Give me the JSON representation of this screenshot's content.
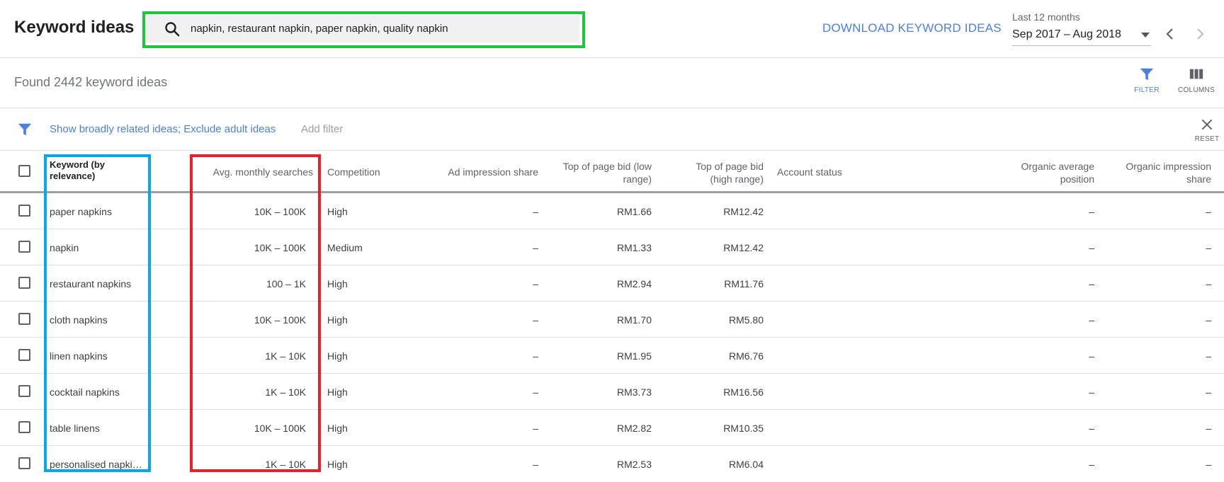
{
  "header": {
    "title": "Keyword ideas",
    "search_value": "napkin, restaurant napkin, paper napkin, quality napkin",
    "download_label": "DOWNLOAD KEYWORD IDEAS",
    "date_range_label": "Last 12 months",
    "date_range_value": "Sep 2017 – Aug 2018"
  },
  "summary": {
    "found_text": "Found 2442 keyword ideas",
    "filter_label": "FILTER",
    "columns_label": "COLUMNS"
  },
  "filter_bar": {
    "active_filter": "Show broadly related ideas; Exclude adult ideas",
    "add_filter_label": "Add filter",
    "reset_label": "RESET"
  },
  "table": {
    "columns": [
      "Keyword (by relevance)",
      "Avg. monthly searches",
      "Competition",
      "Ad impression share",
      "Top of page bid (low range)",
      "Top of page bid (high range)",
      "Account status",
      "Organic average position",
      "Organic impression share"
    ],
    "rows": [
      {
        "keyword": "paper napkins",
        "searches": "10K – 100K",
        "competition": "High",
        "ad_share": "–",
        "bid_low": "RM1.66",
        "bid_high": "RM12.42",
        "account_status": "",
        "organic_position": "–",
        "organic_share": "–"
      },
      {
        "keyword": "napkin",
        "searches": "10K – 100K",
        "competition": "Medium",
        "ad_share": "–",
        "bid_low": "RM1.33",
        "bid_high": "RM12.42",
        "account_status": "",
        "organic_position": "–",
        "organic_share": "–"
      },
      {
        "keyword": "restaurant napkins",
        "searches": "100 – 1K",
        "competition": "High",
        "ad_share": "–",
        "bid_low": "RM2.94",
        "bid_high": "RM11.76",
        "account_status": "",
        "organic_position": "–",
        "organic_share": "–"
      },
      {
        "keyword": "cloth napkins",
        "searches": "10K – 100K",
        "competition": "High",
        "ad_share": "–",
        "bid_low": "RM1.70",
        "bid_high": "RM5.80",
        "account_status": "",
        "organic_position": "–",
        "organic_share": "–"
      },
      {
        "keyword": "linen napkins",
        "searches": "1K – 10K",
        "competition": "High",
        "ad_share": "–",
        "bid_low": "RM1.95",
        "bid_high": "RM6.76",
        "account_status": "",
        "organic_position": "–",
        "organic_share": "–"
      },
      {
        "keyword": "cocktail napkins",
        "searches": "1K – 10K",
        "competition": "High",
        "ad_share": "–",
        "bid_low": "RM3.73",
        "bid_high": "RM16.56",
        "account_status": "",
        "organic_position": "–",
        "organic_share": "–"
      },
      {
        "keyword": "table linens",
        "searches": "10K – 100K",
        "competition": "High",
        "ad_share": "–",
        "bid_low": "RM2.82",
        "bid_high": "RM10.35",
        "account_status": "",
        "organic_position": "–",
        "organic_share": "–"
      },
      {
        "keyword": "personalised napki…",
        "searches": "1K – 10K",
        "competition": "High",
        "ad_share": "–",
        "bid_low": "RM2.53",
        "bid_high": "RM6.04",
        "account_status": "",
        "organic_position": "–",
        "organic_share": "–"
      }
    ]
  },
  "colors": {
    "accent_blue": "#4a7fe6",
    "highlight_green": "#1ec53d",
    "highlight_blue": "#0aa6ea",
    "highlight_red": "#e8202d"
  },
  "icons": {
    "search": "search-icon",
    "filter": "filter-icon",
    "columns": "columns-icon",
    "reset": "close-icon",
    "prev": "chevron-left-icon",
    "next": "chevron-right-icon"
  }
}
